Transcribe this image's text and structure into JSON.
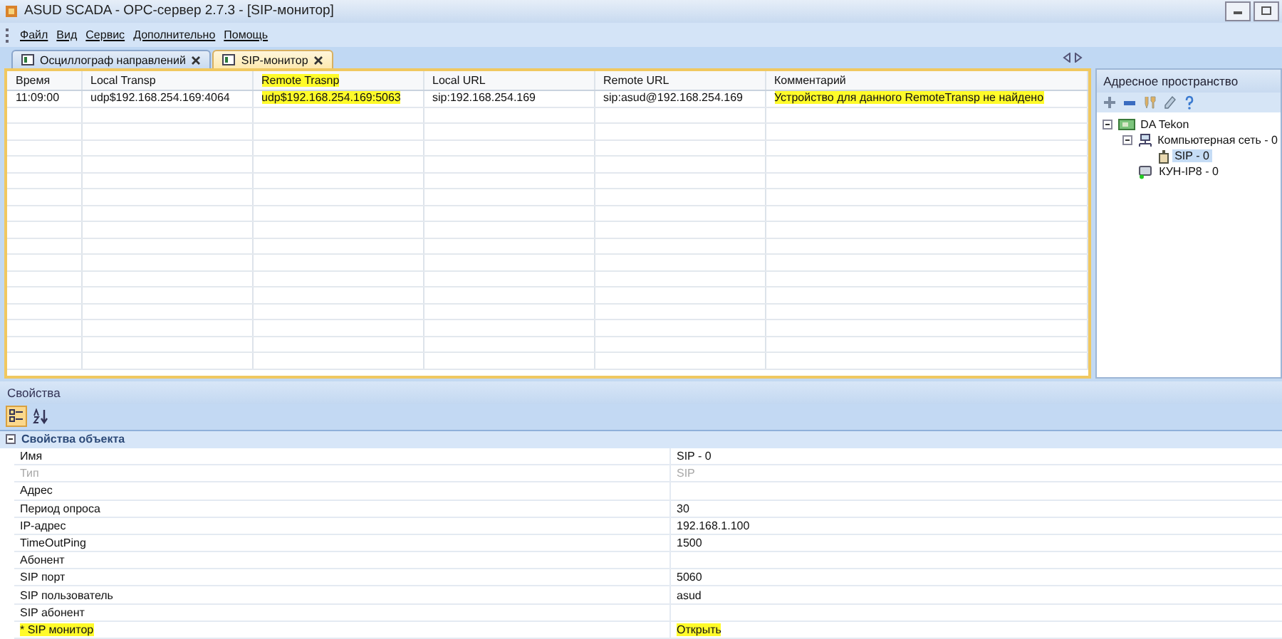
{
  "window": {
    "title": "ASUD SCADA - OPC-сервер 2.7.3 - [SIP-монитор]"
  },
  "menu": [
    "Файл",
    "Вид",
    "Сервис",
    "Дополнительно",
    "Помощь"
  ],
  "tabs": [
    {
      "label": "Осциллограф направлений",
      "selected": false
    },
    {
      "label": "SIP-монитор",
      "selected": true
    }
  ],
  "table": {
    "columns": [
      {
        "label": "Время",
        "highlighted": false
      },
      {
        "label": "Local Transp",
        "highlighted": false
      },
      {
        "label": "Remote Trasnp",
        "highlighted": true
      },
      {
        "label": "Local URL",
        "highlighted": false
      },
      {
        "label": "Remote URL",
        "highlighted": false
      },
      {
        "label": "Комментарий",
        "highlighted": false
      }
    ],
    "rows": [
      {
        "cells": [
          {
            "text": "11:09:00",
            "highlighted": false
          },
          {
            "text": "udp$192.168.254.169:4064",
            "highlighted": false
          },
          {
            "text": "udp$192.168.254.169:5063",
            "highlighted": true
          },
          {
            "text": "sip:192.168.254.169",
            "highlighted": false
          },
          {
            "text": "sip:asud@192.168.254.169",
            "highlighted": false
          },
          {
            "text": "Устройство для данного RemoteTransp не найдено",
            "highlighted": true
          }
        ]
      }
    ]
  },
  "address_panel": {
    "title": "Адресное пространство",
    "tree": [
      {
        "label": "DA Tekon",
        "kind": "board",
        "selected": false,
        "expanded": true,
        "children": [
          {
            "label": "Компьютерная сеть - 0",
            "kind": "network",
            "selected": false,
            "expanded": true,
            "children": [
              {
                "label": "SIP - 0",
                "kind": "device",
                "selected": true
              }
            ]
          },
          {
            "label": "КУН-IP8 - 0",
            "kind": "phone",
            "selected": false
          }
        ]
      }
    ]
  },
  "properties": {
    "title": "Свойства",
    "view_buttons": [
      {
        "kind": "categorized",
        "selected": true
      },
      {
        "kind": "alphabetical",
        "selected": false
      }
    ],
    "category": {
      "label": "Свойства объекта",
      "expanded": true
    },
    "rows": [
      {
        "name": {
          "text": "Имя",
          "highlighted": false
        },
        "value": {
          "text": "SIP - 0",
          "highlighted": false
        },
        "disabled": false
      },
      {
        "name": {
          "text": "Тип",
          "highlighted": false
        },
        "value": {
          "text": "SIP",
          "highlighted": false
        },
        "disabled": true
      },
      {
        "name": {
          "text": "Адрес",
          "highlighted": false
        },
        "disabled": false
      },
      {
        "name": {
          "text": "Период опроса",
          "highlighted": false
        },
        "value": {
          "text": "30",
          "highlighted": false
        },
        "disabled": false
      },
      {
        "name": {
          "text": "IP-адрес",
          "highlighted": false
        },
        "value": {
          "text": "192.168.1.100",
          "highlighted": false
        },
        "disabled": false
      },
      {
        "name": {
          "text": "TimeOutPing",
          "highlighted": false
        },
        "value": {
          "text": "1500",
          "highlighted": false
        },
        "disabled": false
      },
      {
        "name": {
          "text": "Абонент",
          "highlighted": false
        },
        "disabled": false
      },
      {
        "name": {
          "text": "SIP порт",
          "highlighted": false
        },
        "value": {
          "text": "5060",
          "highlighted": false
        },
        "disabled": false
      },
      {
        "name": {
          "text": "SIP пользователь",
          "highlighted": false
        },
        "value": {
          "text": "asud",
          "highlighted": false
        },
        "disabled": false
      },
      {
        "name": {
          "text": "SIP абонент",
          "highlighted": false
        },
        "disabled": false
      },
      {
        "name": {
          "text": "* SIP монитор",
          "highlighted": true
        },
        "value": {
          "text": "Открыть",
          "highlighted": true
        },
        "disabled": false
      }
    ]
  }
}
